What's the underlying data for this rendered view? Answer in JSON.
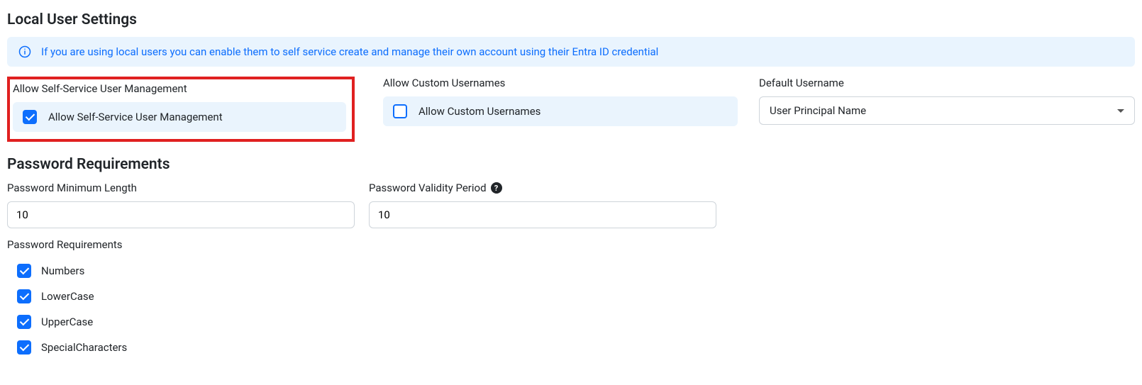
{
  "localUserSettings": {
    "title": "Local User Settings",
    "info_text": "If you are using local users you can enable them to self service create and manage their own account using their Entra ID credential",
    "fields": {
      "selfService": {
        "label": "Allow Self-Service User Management",
        "checkbox_label": "Allow Self-Service User Management",
        "checked": true
      },
      "customUsernames": {
        "label": "Allow Custom Usernames",
        "checkbox_label": "Allow Custom Usernames",
        "checked": false
      },
      "defaultUsername": {
        "label": "Default Username",
        "selected": "User Principal Name"
      }
    }
  },
  "passwordRequirements": {
    "title": "Password Requirements",
    "minLength": {
      "label": "Password Minimum Length",
      "value": "10"
    },
    "validity": {
      "label": "Password Validity Period",
      "value": "10"
    },
    "reqListLabel": "Password Requirements",
    "reqs": [
      {
        "label": "Numbers",
        "checked": true
      },
      {
        "label": "LowerCase",
        "checked": true
      },
      {
        "label": "UpperCase",
        "checked": true
      },
      {
        "label": "SpecialCharacters",
        "checked": true
      }
    ]
  }
}
